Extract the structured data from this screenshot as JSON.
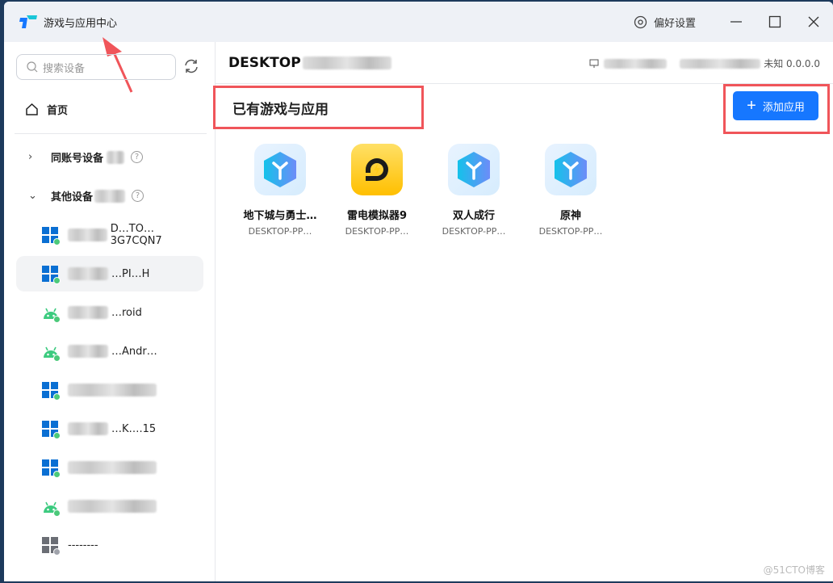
{
  "window": {
    "title": "游戏与应用中心",
    "preferences": "偏好设置"
  },
  "sidebar": {
    "search_placeholder": "搜索设备",
    "home": "首页",
    "groups": [
      {
        "label": "同账号设备",
        "expanded": false
      },
      {
        "label": "其他设备",
        "expanded": true
      }
    ],
    "devices": [
      {
        "os": "windows",
        "visible_text": "D…TO…3G7CQN7",
        "online": true,
        "selected": false
      },
      {
        "os": "windows",
        "visible_text": "…PI…H",
        "online": true,
        "selected": true
      },
      {
        "os": "android",
        "visible_text": "…roid",
        "online": true
      },
      {
        "os": "android",
        "visible_text": "…Andr…",
        "online": true
      },
      {
        "os": "windows",
        "visible_text": "",
        "online": true
      },
      {
        "os": "windows",
        "visible_text": "…K….15",
        "online": true
      },
      {
        "os": "windows",
        "visible_text": "",
        "online": true
      },
      {
        "os": "android",
        "visible_text": "",
        "online": true
      },
      {
        "os": "windows",
        "visible_text": "--------",
        "online": false
      }
    ]
  },
  "main": {
    "device_name": "DESKTOP",
    "device_status": "未知 0.0.0.0",
    "section_title": "已有游戏与应用",
    "add_button": "添加应用",
    "apps": [
      {
        "name": "地下城与勇士…",
        "device": "DESKTOP-PP…",
        "icon": "cube"
      },
      {
        "name": "雷电模拟器9",
        "device": "DESKTOP-PP…",
        "icon": "ldplayer"
      },
      {
        "name": "双人成行",
        "device": "DESKTOP-PP…",
        "icon": "cube"
      },
      {
        "name": "原神",
        "device": "DESKTOP-PP…",
        "icon": "cube"
      }
    ]
  },
  "watermark": "@51CTO博客",
  "colors": {
    "accent": "#1677ff",
    "highlight": "#f0555a",
    "online": "#4cc97a"
  }
}
